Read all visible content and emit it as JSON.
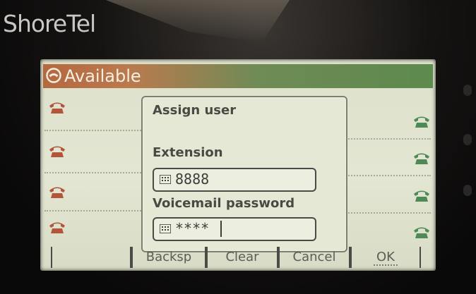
{
  "device": {
    "brand": "ShoreTel"
  },
  "status_bar": {
    "icon": "presence-icon",
    "label": "Available"
  },
  "lines": {
    "left_icons": [
      "phone-icon",
      "phone-icon",
      "phone-icon",
      "phone-icon"
    ],
    "right_icons": [
      "phone-icon",
      "phone-icon",
      "phone-icon",
      "phone-icon"
    ],
    "left_color": "#b2553a",
    "right_color": "#4d8a55"
  },
  "dialog": {
    "title": "Assign user",
    "extension_label": "Extension",
    "extension_value": "8888",
    "password_label": "Voicemail password",
    "password_value": "****"
  },
  "softkeys": [
    "",
    "Backsp",
    "Clear",
    "Cancel",
    "OK"
  ]
}
